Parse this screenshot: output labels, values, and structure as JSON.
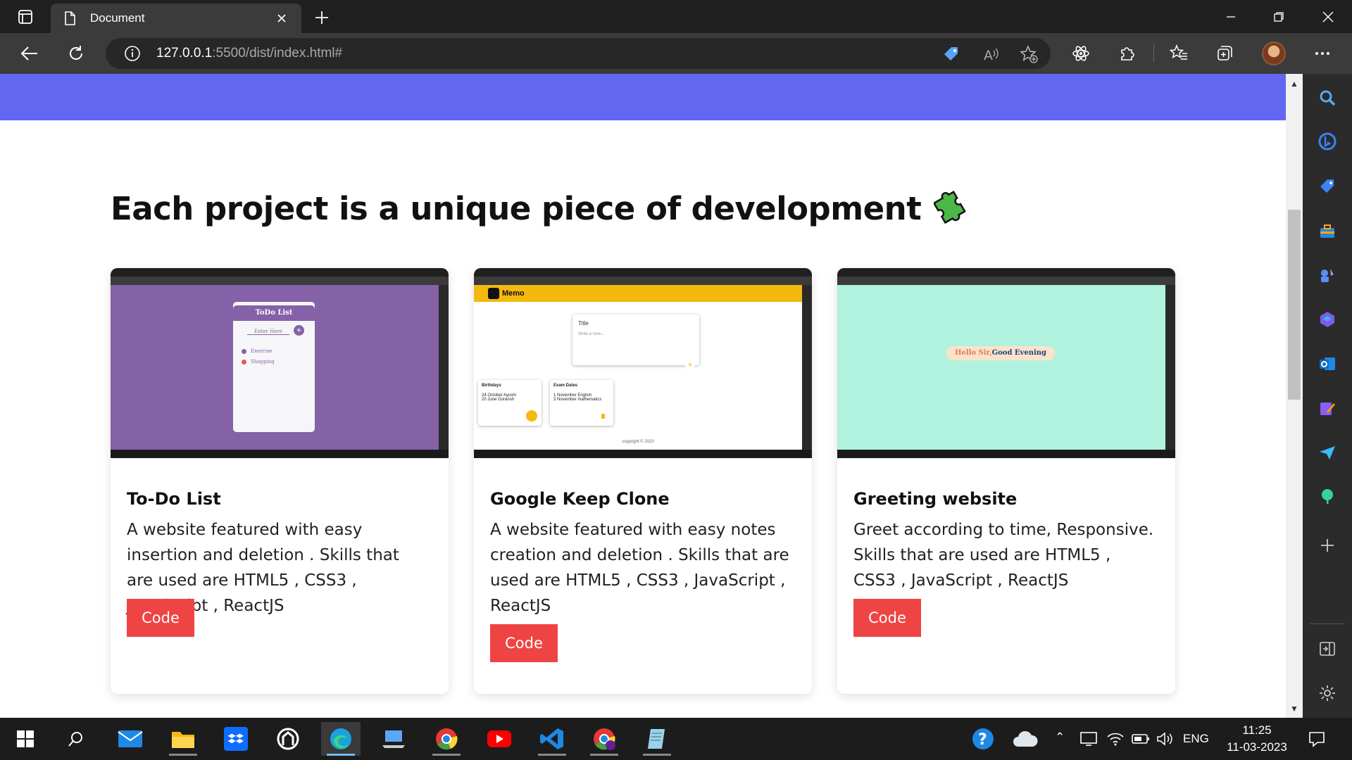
{
  "browser": {
    "tab_title": "Document",
    "url_host": "127.0.0.1",
    "url_rest": ":5500/dist/index.html#"
  },
  "page": {
    "heading": "Each project is a unique piece of development",
    "projects": [
      {
        "title": "To-Do List",
        "description": "A website featured with easy insertion and deletion . Skills that are used are HTML5 , CSS3 , JavaScript , ReactJS",
        "button": "Code",
        "preview": {
          "app_title": "ToDo List",
          "input_placeholder": "Enter Here",
          "items": [
            "Exercise",
            "Shopping"
          ]
        }
      },
      {
        "title": "Google Keep Clone",
        "description": "A website featured with easy notes creation and deletion . Skills that are used are HTML5 , CSS3 , JavaScript , ReactJS",
        "button": "Code",
        "preview": {
          "brand": "Memo",
          "note_title": "Title",
          "note_placeholder": "Write a note...",
          "notes": [
            {
              "title": "Birthdays",
              "lines": [
                "24 October Ayushi",
                "20 June Goransh"
              ]
            },
            {
              "title": "Exam Dates",
              "lines": [
                "1 November English",
                "3 November mathematics"
              ]
            }
          ],
          "footer": "copyright © 2023"
        }
      },
      {
        "title": "Greeting website",
        "description": "Greet according to time, Responsive. Skills that are used are HTML5 , CSS3 , JavaScript , ReactJS",
        "button": "Code",
        "preview": {
          "greeting_a": "Hello Sir,",
          "greeting_b": "Good Evening"
        }
      }
    ]
  },
  "taskbar": {
    "language": "ENG",
    "time": "11:25",
    "date": "11-03-2023"
  },
  "colors": {
    "navbar": "#6366f1",
    "code_button": "#ef4444",
    "todo_bg": "#8561a8",
    "keep_header": "#f5b80f",
    "greeting_bg": "#b0f2de"
  }
}
